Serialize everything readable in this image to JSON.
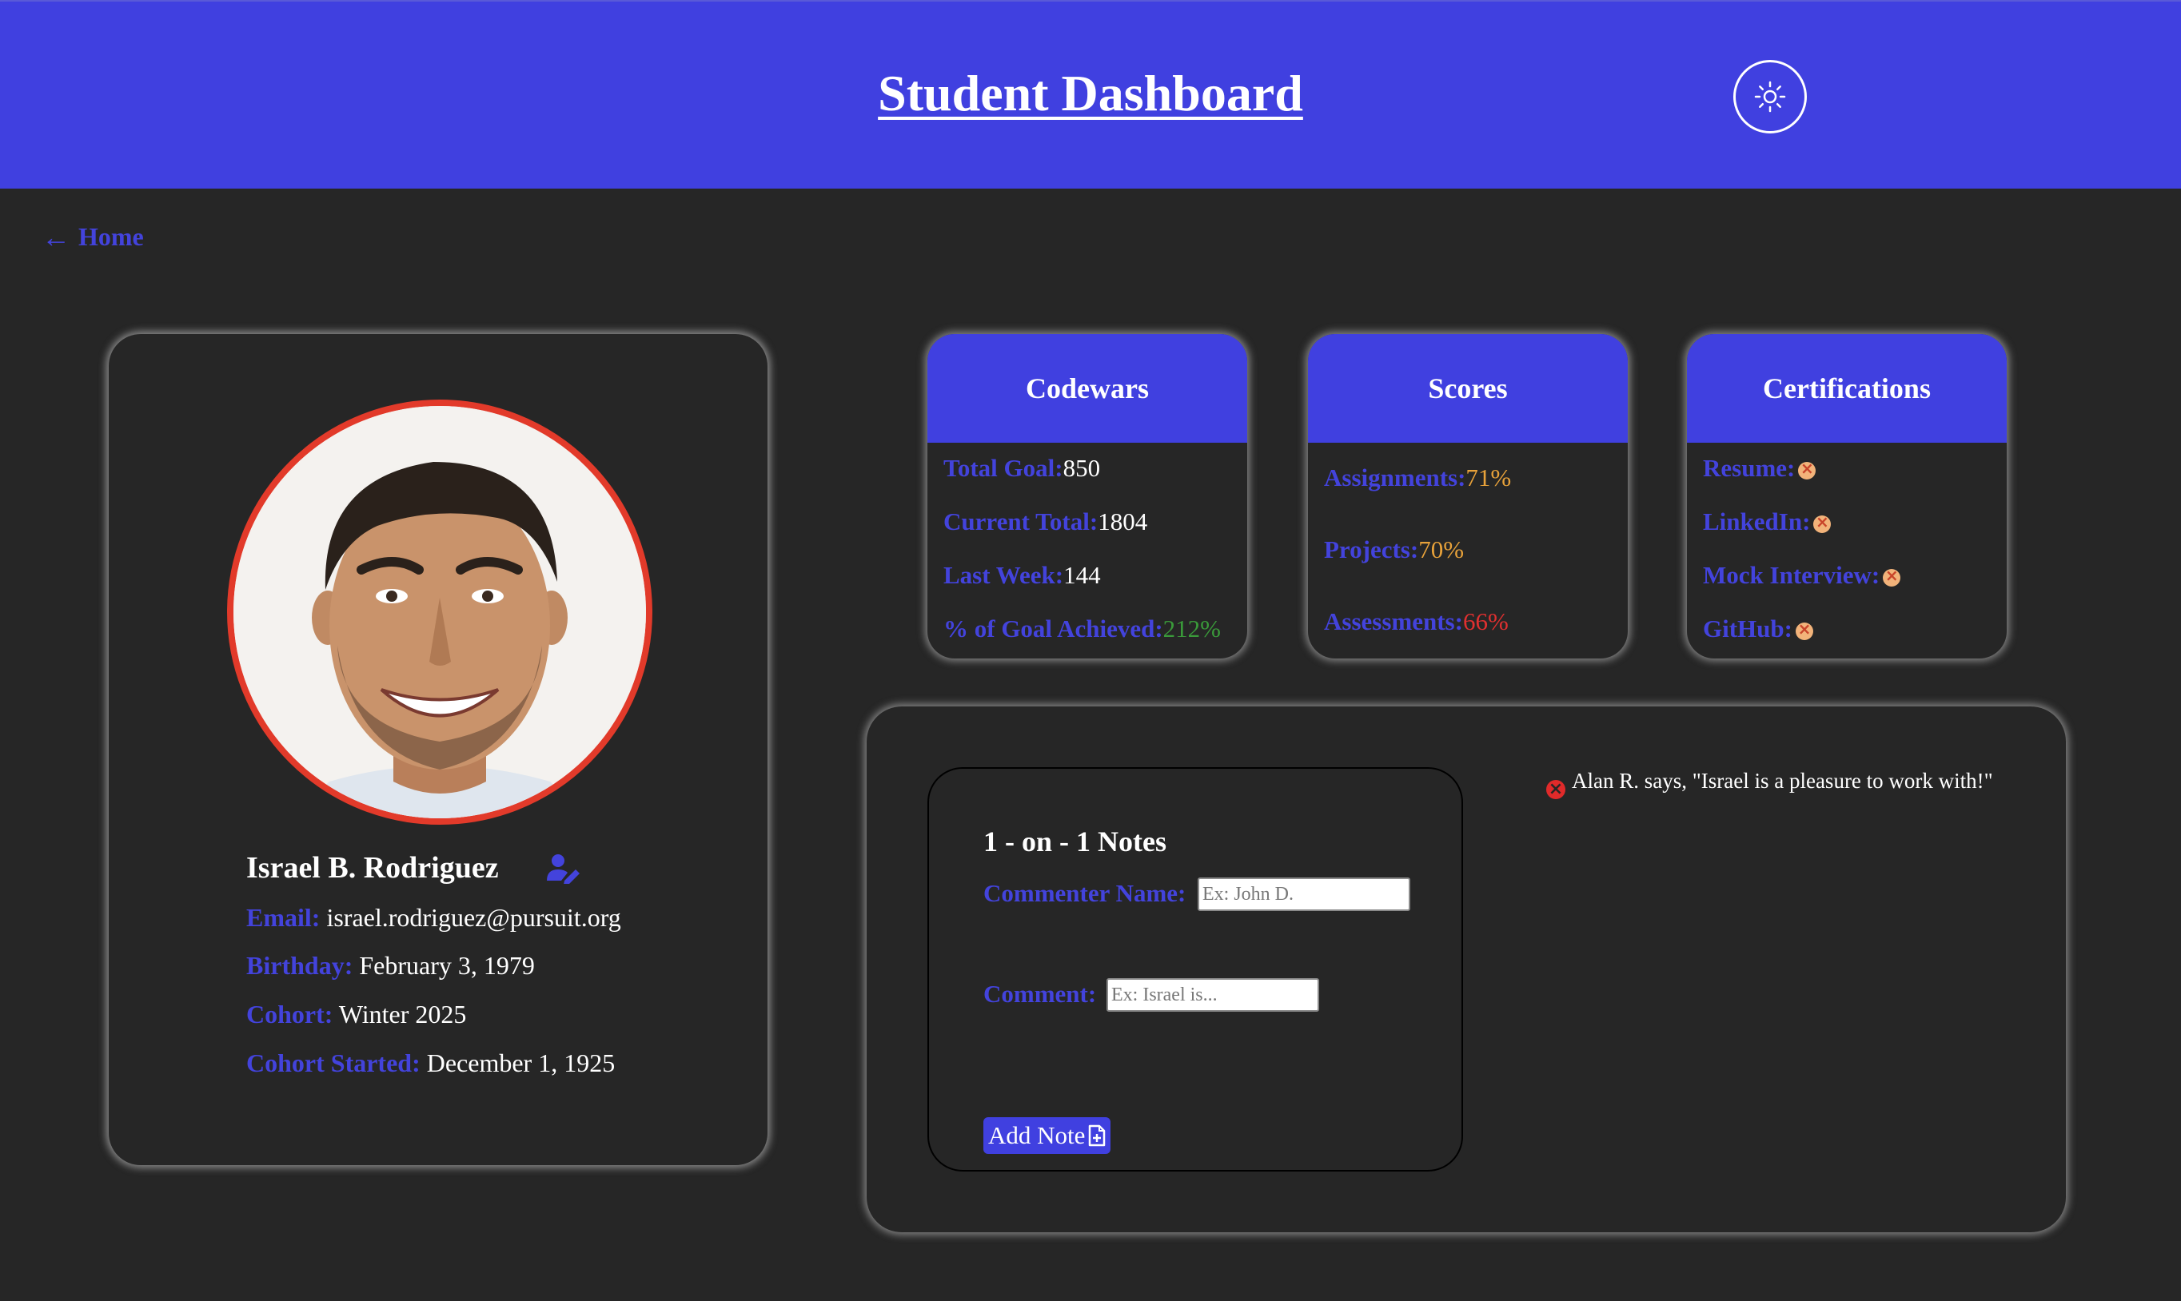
{
  "header": {
    "title": "Student Dashboard",
    "theme_toggle_icon": "sun-icon"
  },
  "nav": {
    "home_label": "Home",
    "home_icon": "arrow-left-icon"
  },
  "profile": {
    "name": "Israel B. Rodriguez",
    "edit_icon": "user-edit-icon",
    "fields": [
      {
        "label": "Email:",
        "value": "israel.rodriguez@pursuit.org"
      },
      {
        "label": "Birthday:",
        "value": "February 3, 1979"
      },
      {
        "label": "Cohort:",
        "value": "Winter 2025"
      },
      {
        "label": "Cohort Started:",
        "value": "December 1, 1925"
      }
    ],
    "avatar_border_color": "#e23a2a"
  },
  "codewars": {
    "title": "Codewars",
    "rows": [
      {
        "label": "Total Goal:",
        "value": "850",
        "color": "#ffffff"
      },
      {
        "label": "Current Total:",
        "value": "1804",
        "color": "#ffffff"
      },
      {
        "label": "Last Week:",
        "value": "144",
        "color": "#ffffff"
      },
      {
        "label": "% of Goal Achieved:",
        "value": "212%",
        "color": "#3a9a3a"
      }
    ]
  },
  "scores": {
    "title": "Scores",
    "rows": [
      {
        "label": "Assignments:",
        "value": "71%",
        "color": "#e8a23a"
      },
      {
        "label": "Projects:",
        "value": "70%",
        "color": "#e8a23a"
      },
      {
        "label": "Assessments:",
        "value": "66%",
        "color": "#e03030"
      }
    ]
  },
  "certifications": {
    "title": "Certifications",
    "rows": [
      {
        "label": "Resume:",
        "status_icon": "x-circle-icon"
      },
      {
        "label": "LinkedIn:",
        "status_icon": "x-circle-icon"
      },
      {
        "label": "Mock Interview:",
        "status_icon": "x-circle-icon"
      },
      {
        "label": "GitHub:",
        "status_icon": "x-circle-icon"
      }
    ]
  },
  "notes": {
    "title": "1 - on - 1 Notes",
    "commenter_label": "Commenter Name:",
    "commenter_placeholder": "Ex: John D.",
    "comment_label": "Comment:",
    "comment_placeholder": "Ex: Israel is...",
    "add_button_label": "Add Note",
    "add_button_icon": "file-plus-icon",
    "comments": [
      {
        "text": "Alan R. says, \"Israel is a pleasure to work with!\""
      }
    ]
  },
  "colors": {
    "accent": "#4040e0",
    "label": "#4343dc",
    "background": "#262626"
  }
}
